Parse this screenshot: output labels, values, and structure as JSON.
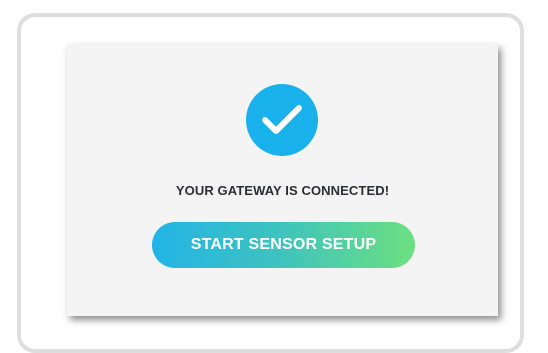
{
  "status": {
    "title": "YOUR GATEWAY IS CONNECTED!",
    "icon": "check-circle-icon"
  },
  "actions": {
    "start_setup_label": "START SENSOR SETUP"
  },
  "colors": {
    "badge": "#19b1ec",
    "button_gradient_start": "#22b4e6",
    "button_gradient_end": "#6de07f",
    "card_background": "#f4f4f4",
    "frame_border": "#dedede"
  }
}
